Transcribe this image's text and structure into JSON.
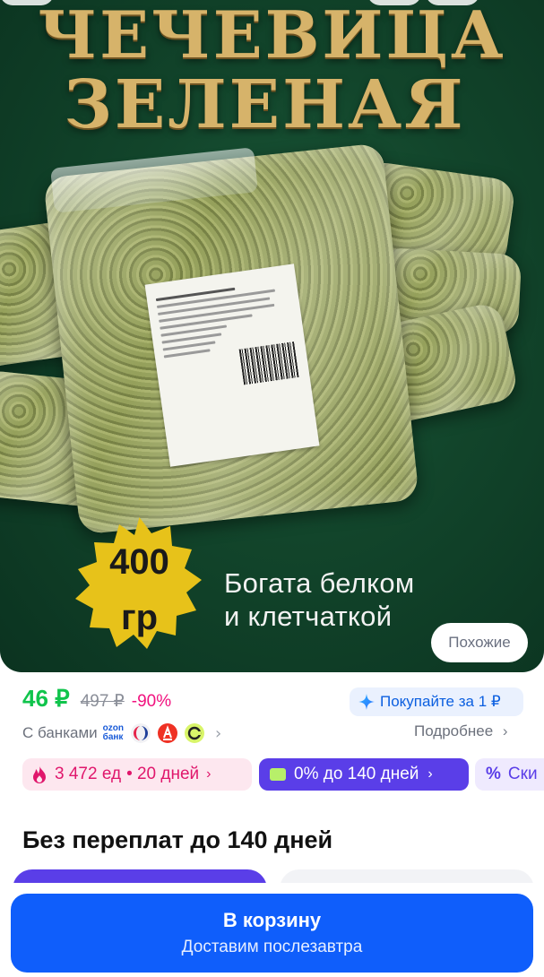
{
  "image": {
    "title_line1": "ЧЕЧЕВИЦА",
    "title_line2": "ЗЕЛЕНАЯ",
    "badge_weight": "400",
    "badge_unit": "гр",
    "tagline_line1": "Богата белком",
    "tagline_line2": "и клетчаткой",
    "similar_button": "Похожие"
  },
  "price": {
    "current": "46 ₽",
    "old": "497 ₽",
    "discount": "-90%",
    "promo": "Покупайте за 1 ₽",
    "banks_label": "С банками",
    "ozon_line1": "ozon",
    "ozon_line2": "банк",
    "details": "Подробнее"
  },
  "chips": {
    "sold": "3 472 ед",
    "days": "• 20 дней",
    "installment": "0% до 140 дней",
    "third": "Ски"
  },
  "section": {
    "title": "Без переплат до 140 дней"
  },
  "cart": {
    "label": "В корзину",
    "delivery": "Доставим послезавтра"
  },
  "colors": {
    "accent": "#0f5efb",
    "price_green": "#10c44c",
    "discount_pink": "#f1117e",
    "installment_purple": "#5a3ee8"
  }
}
